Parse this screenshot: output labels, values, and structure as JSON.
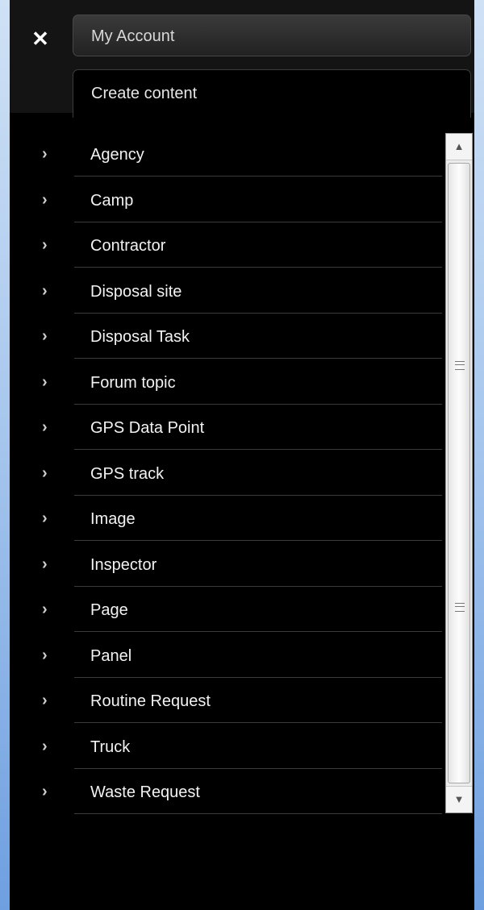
{
  "header": {
    "close_icon": "close-icon",
    "account_tab": "My Account",
    "create_tab": "Create content"
  },
  "content_types": [
    "Agency",
    "Camp",
    "Contractor",
    "Disposal site",
    "Disposal Task",
    "Forum topic",
    "GPS Data Point",
    "GPS track",
    "Image",
    "Inspector",
    "Page",
    "Panel",
    "Routine Request",
    "Truck",
    "Waste Request"
  ],
  "colors": {
    "panel_bg": "#000000",
    "header_bg": "#141414",
    "text": "#f2f2f2",
    "background_blue": "#a9c8ee"
  },
  "icons": {
    "chevron": "chevron-right-icon",
    "scroll_up": "scroll-up-arrow-icon",
    "scroll_down": "scroll-down-arrow-icon",
    "grip": "grip-lines-icon"
  }
}
